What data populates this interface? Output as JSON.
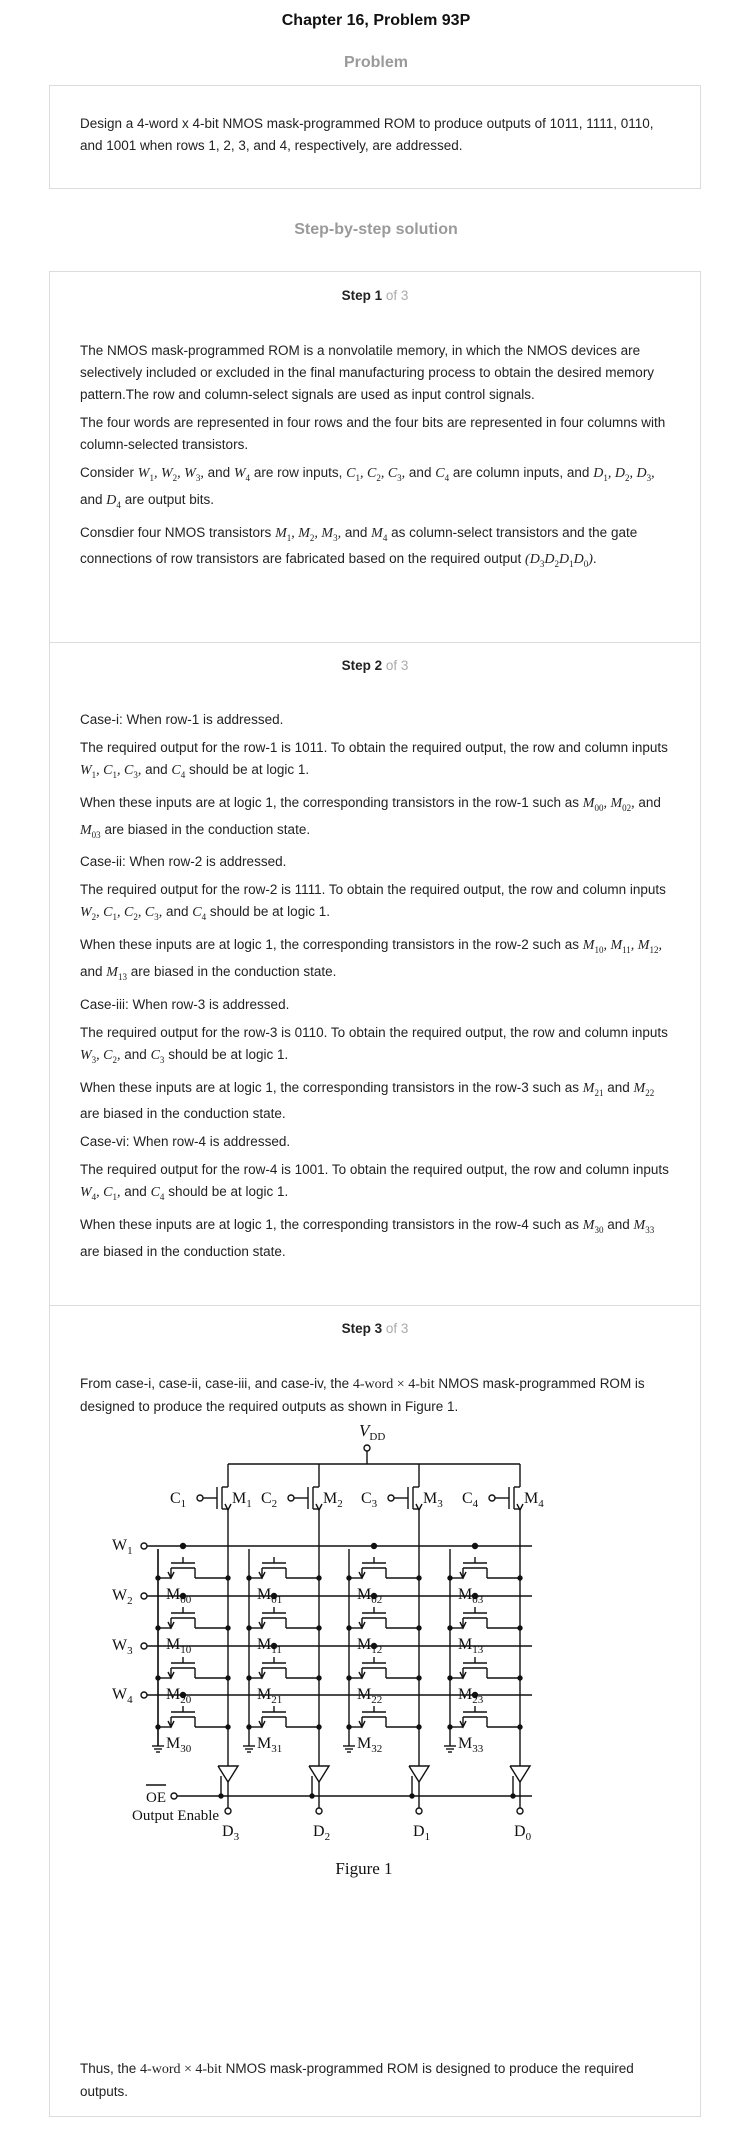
{
  "title": "Chapter 16, Problem 93P",
  "problem_heading": "Problem",
  "problem_text": "Design a 4-word x 4-bit NMOS mask-programmed ROM to produce outputs of 1011, 1111, 0110, and 1001 when rows 1, 2, 3, and 4, respectively, are addressed.",
  "solution_heading": "Step-by-step solution",
  "steps": [
    {
      "label": "Step 1",
      "of": " of 3"
    },
    {
      "label": "Step 2",
      "of": " of 3"
    },
    {
      "label": "Step 3",
      "of": " of 3"
    }
  ],
  "s1": {
    "p1": "The NMOS mask-programmed ROM is a nonvolatile memory, in which the NMOS devices are selectively included or excluded in the final manufacturing process to obtain the desired memory pattern.The row and column-select signals are used as input control signals.",
    "p2": "The four words are represented in four rows and the four bits are represented in four columns with column-selected transistors.",
    "p3a": "Consider",
    "p3b": "are row inputs,",
    "p3c": "are column inputs, and",
    "p3d": "are output bits.",
    "p4a": "Consdier four NMOS transistors",
    "p4b": "as column-select transistors and the gate connections of row transistors are fabricated based on the required output",
    "and": "and"
  },
  "s2": {
    "c1": "Case-i: When row-1 is addressed.",
    "c1a": "The required output for the row-1 is 1011. To obtain the required output, the row and column inputs",
    "c1b": "should be at logic 1.",
    "c1c": "When these inputs are at logic 1, the corresponding transistors in the row-1 such as",
    "c1d": "are biased in the conduction state.",
    "c2": "Case-ii: When row-2 is addressed.",
    "c2a": "The required output for the row-2 is 1111. To obtain the required output, the row and column inputs",
    "c2b": "should be at logic 1.",
    "c2c": "When these inputs are at logic 1, the corresponding transistors in the row-2 such as",
    "c2d": "are biased in the conduction state.",
    "c3": "Case-iii: When row-3 is addressed.",
    "c3a": "The required output for the row-3 is 0110. To obtain the required output, the row and column inputs",
    "c3b": "should be at logic 1.",
    "c3c": "When these inputs are at logic 1, the corresponding transistors in the row-3 such as",
    "c3d": "are biased in the conduction state.",
    "c4": "Case-vi: When row-4 is addressed.",
    "c4a": "The required output for the row-4 is 1001. To obtain the required output, the row and column inputs",
    "c4b": "should be at logic 1.",
    "c4c": "When these inputs are at logic 1, the corresponding transistors in the row-4 such as",
    "c4d": "are biased in the conduction state.",
    "and": "and"
  },
  "s3": {
    "p1a": "From case-i, case-ii, case-iii, and case-iv, the",
    "p1b": "NMOS mask-programmed ROM is designed to produce the required outputs as shown in Figure 1.",
    "p2a": "Thus, the",
    "p2b": "NMOS mask-programmed ROM is designed to produce the required outputs.",
    "size": "4-word × 4-bit"
  },
  "figure": {
    "vdd": "V",
    "vdd_sub": "DD",
    "caption": "Figure 1",
    "oe": "OE",
    "output_enable": "Output Enable",
    "columns": [
      {
        "c": "C",
        "ci": "1",
        "m": "M",
        "mi": "1",
        "d": "D",
        "di": "3"
      },
      {
        "c": "C",
        "ci": "2",
        "m": "M",
        "mi": "2",
        "d": "D",
        "di": "2"
      },
      {
        "c": "C",
        "ci": "3",
        "m": "M",
        "mi": "3",
        "d": "D",
        "di": "1"
      },
      {
        "c": "C",
        "ci": "4",
        "m": "M",
        "mi": "4",
        "d": "D",
        "di": "0"
      }
    ],
    "rows": [
      {
        "w": "W",
        "wi": "1",
        "cells": [
          "00",
          "01",
          "02",
          "03"
        ]
      },
      {
        "w": "W",
        "wi": "2",
        "cells": [
          "10",
          "11",
          "12",
          "13"
        ]
      },
      {
        "w": "W",
        "wi": "3",
        "cells": [
          "20",
          "21",
          "22",
          "23"
        ]
      },
      {
        "w": "W",
        "wi": "4",
        "cells": [
          "30",
          "31",
          "32",
          "33"
        ]
      }
    ],
    "connected": [
      [
        1,
        0,
        1,
        1
      ],
      [
        1,
        1,
        1,
        1
      ],
      [
        0,
        1,
        1,
        0
      ],
      [
        1,
        0,
        0,
        1
      ]
    ]
  }
}
